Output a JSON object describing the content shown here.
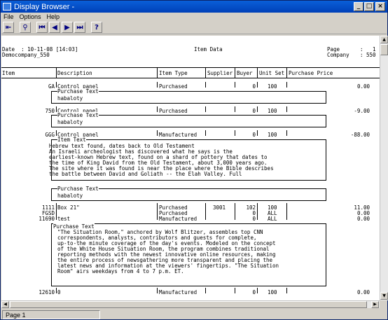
{
  "window": {
    "title": "Display Browser -"
  },
  "menu": [
    "File",
    "Options",
    "Help"
  ],
  "toolbar": {
    "help_label": "?"
  },
  "report": {
    "date_line": "Date  : 10-11-08 [14:03]",
    "company_line": "Democompany_550",
    "title": "Item Data",
    "page_label": "Page",
    "page_value": "1",
    "company_label": "Company",
    "company_value": "550",
    "colon": ":",
    "columns": [
      "Item",
      "Description",
      "Item Type",
      "Supplier",
      "Buyer",
      "Unit Set",
      "Purchase Price"
    ],
    "rows": [
      {
        "item": "GA",
        "desc": "Control panel",
        "type": "Purchased",
        "supplier": "",
        "buyer": "0",
        "unit": "100",
        "price": "0.00"
      },
      {
        "item": "750",
        "desc": "Control panel",
        "type": "Purchased",
        "supplier": "",
        "buyer": "0",
        "unit": "100",
        "price": "-9.00"
      },
      {
        "item": "GGG",
        "desc": "Control panel",
        "type": "Manufactured",
        "supplier": "",
        "buyer": "0",
        "unit": "100",
        "price": "-88.00"
      },
      {
        "item": "1111",
        "desc": "Box 21\"",
        "type": "Purchased",
        "supplier": "3001",
        "buyer": "102",
        "unit": "100",
        "price": "11.00"
      },
      {
        "item": "FGSD",
        "desc": "",
        "type": "Purchased",
        "supplier": "",
        "buyer": "0",
        "unit": "ALL",
        "price": "0.00"
      },
      {
        "item": "11690",
        "desc": "test",
        "type": "Manufactured",
        "supplier": "",
        "buyer": "0",
        "unit": "ALL",
        "price": "0.00"
      },
      {
        "item": "12610",
        "desc": "0",
        "type": "Manufactured",
        "supplier": "",
        "buyer": "0",
        "unit": "100",
        "price": "0.00"
      }
    ],
    "purchase_text_label": "Purchase Text",
    "item_text_label": "Item Text",
    "text_habaloty": "habaloty",
    "item_text_lines": [
      "Hebrew text found, dates back to Old Testament",
      "An Israeli archeologist has discovered what he says is the",
      "earliest-known Hebrew text, found on a shard of pottery that dates to",
      "the time of King David from the Old Testament, about 3,000 years ago.",
      "The site where it was found is near the place where the Bible describes",
      "the battle between David and Goliath -- the Elah Valley. Full"
    ],
    "situation_lines": [
      "\"The Situation Room,\" anchored by Wolf Blitzer, assembles top CNN",
      "correspondents, analysts, contributors and guests for complete,",
      "up-to-the minute coverage of the day's events. Modeled on the concept",
      "of the White House Situation Room, the program combines traditional",
      "reporting methods with the newest innovative online resources, making",
      "the entire process of newsgathering more transparent and placing the",
      "latest news and information at the viewers' fingertips. \"The Situation",
      "Room\" airs weekdays from 4 to 7 p.m. ET."
    ]
  },
  "status": {
    "page": "Page 1"
  }
}
